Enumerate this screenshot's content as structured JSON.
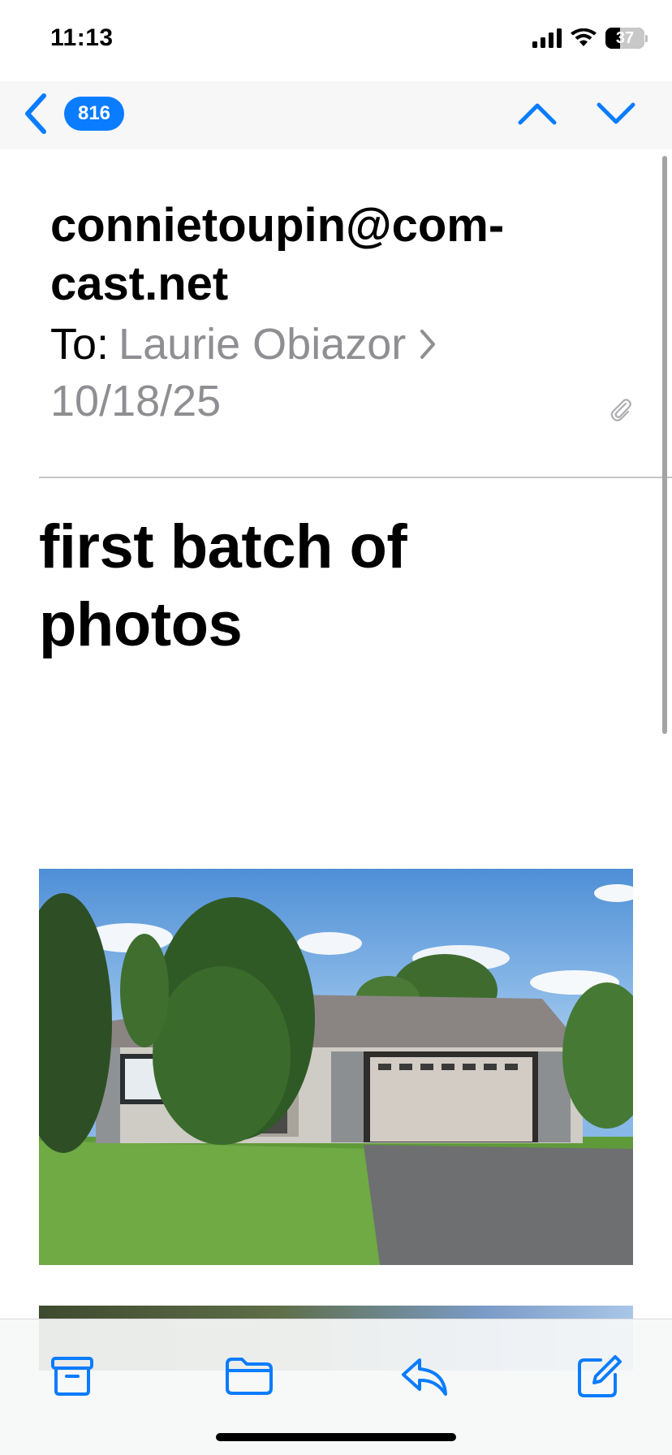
{
  "status_bar": {
    "time": "11:13",
    "battery_percent": "37",
    "battery_level": 0.37,
    "icons": [
      "signal-icon",
      "wifi-icon",
      "battery-icon"
    ]
  },
  "nav": {
    "unread_count": "816",
    "icons": [
      "back-chevron-icon",
      "chevron-up-icon",
      "chevron-down-icon"
    ]
  },
  "message": {
    "sender": "connietoupin@com-cast.net",
    "sender_line1": "connietoupin@com-",
    "sender_line2": "cast.net",
    "to_label": "To:",
    "recipient": "Laurie Obiazor",
    "date": "10/18/25",
    "subject_line1": "first batch of",
    "subject_line2": "photos",
    "has_attachment": true
  },
  "colors": {
    "accent": "#0a7cff",
    "secondary_text": "#8e8e93",
    "divider": "#c6c6c8"
  },
  "toolbar": {
    "icons": [
      "archive-icon",
      "folder-icon",
      "reply-icon",
      "compose-icon"
    ]
  }
}
